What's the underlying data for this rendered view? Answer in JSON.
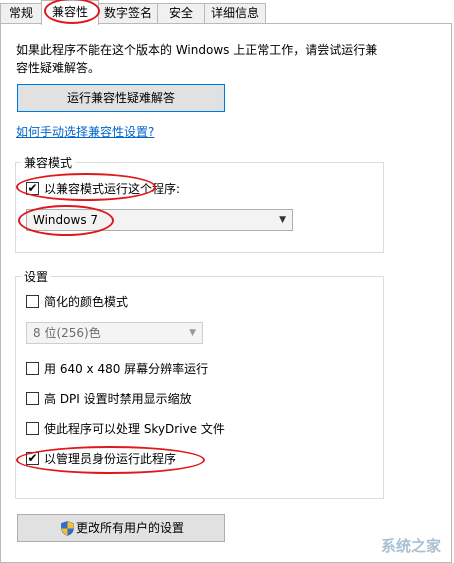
{
  "tabs": [
    {
      "label": "常规"
    },
    {
      "label": "兼容性"
    },
    {
      "label": "数字签名"
    },
    {
      "label": "安全"
    },
    {
      "label": "详细信息"
    }
  ],
  "intro_text_line1": "如果此程序不能在这个版本的 Windows 上正常工作，请尝试运行兼",
  "intro_text_line2": "容性疑难解答。",
  "troubleshooter_button": "运行兼容性疑难解答",
  "manual_link": "如何手动选择兼容性设置?",
  "compat_mode": {
    "legend": "兼容模式",
    "checkbox_label": "以兼容模式运行这个程序:",
    "checked": true,
    "selected_os": "Windows 7"
  },
  "settings": {
    "legend": "设置",
    "reduced_color": {
      "label": "简化的颜色模式",
      "checked": false
    },
    "color_depth": {
      "value": "8 位(256)色"
    },
    "res_640": {
      "label": "用 640 x 480 屏幕分辨率运行",
      "checked": false
    },
    "high_dpi": {
      "label": "高 DPI 设置时禁用显示缩放",
      "checked": false
    },
    "skydrive": {
      "label": "使此程序可以处理 SkyDrive 文件",
      "checked": false
    },
    "run_as_admin": {
      "label": "以管理员身份运行此程序",
      "checked": true
    }
  },
  "all_users_button": "更改所有用户的设置",
  "check_mark": "✔",
  "dropdown_arrow": "▼",
  "watermark": "系统之家",
  "colors": {
    "annotation_ring": "#e0171b",
    "link": "#0066cc"
  }
}
